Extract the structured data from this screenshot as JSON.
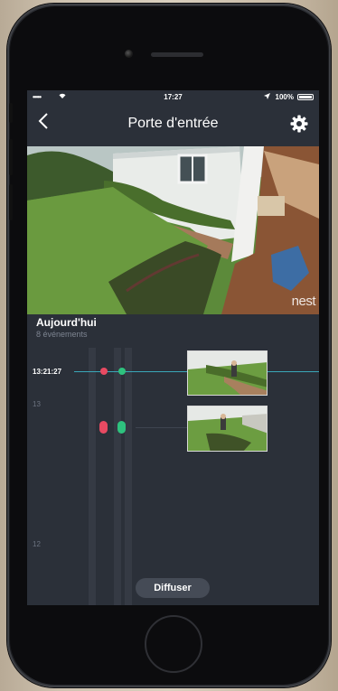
{
  "statusbar": {
    "signal": "•••••",
    "time": "17:27",
    "battery": "100%",
    "battery_level": 1.0
  },
  "navbar": {
    "back_icon": "chevron-left-icon",
    "title": "Porte d'entrée",
    "settings_icon": "gear-icon"
  },
  "feed": {
    "watermark": "nest"
  },
  "timeline": {
    "day_title": "Aujourd'hui",
    "event_count": "8 événements",
    "current_time": "13:21:27",
    "hour_labels": [
      "13",
      "12"
    ],
    "colors": {
      "accent": "#3aa7b8",
      "motion": "#e84a62",
      "sound": "#2ec27e"
    }
  },
  "footer": {
    "stream_button": "Diffuser"
  }
}
